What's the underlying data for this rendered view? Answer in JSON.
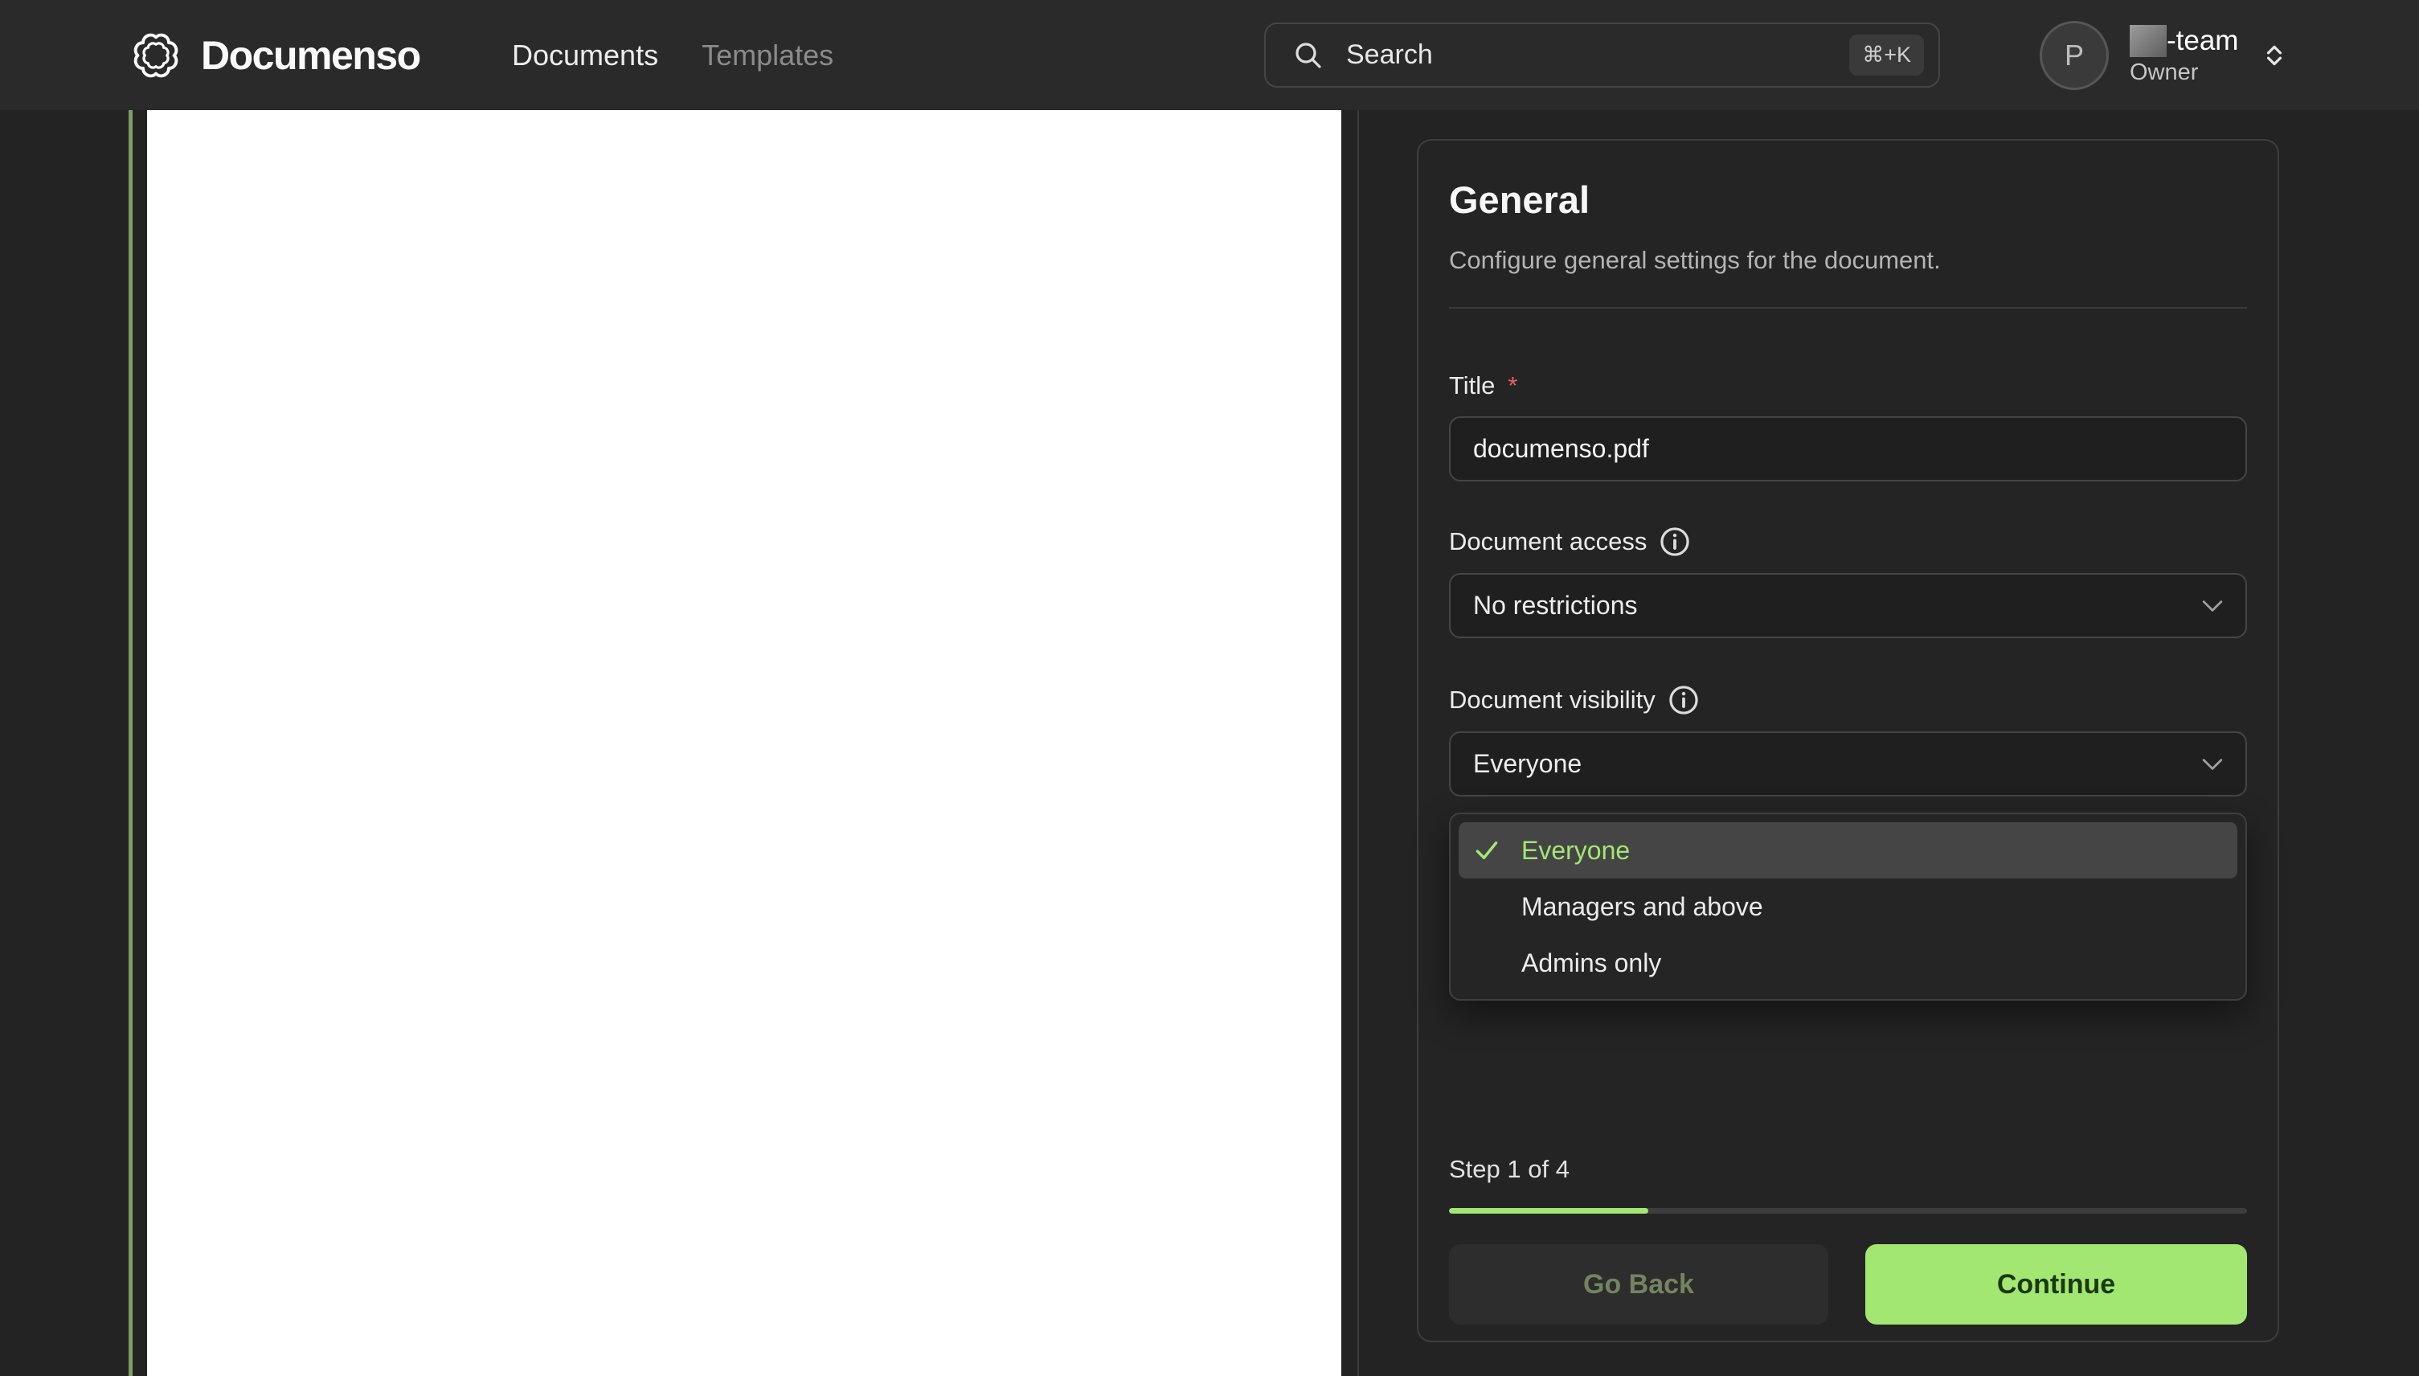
{
  "navbar": {
    "brand": "Documenso",
    "nav_items": [
      {
        "label": "Documents",
        "active": true
      },
      {
        "label": "Templates",
        "active": false
      }
    ],
    "search": {
      "placeholder": "Search",
      "shortcut": "⌘+K"
    },
    "user": {
      "avatar_initial": "P",
      "team_suffix": "-team",
      "role": "Owner"
    }
  },
  "panel": {
    "title": "General",
    "subtitle": "Configure general settings for the document.",
    "fields": {
      "title": {
        "label": "Title",
        "required_mark": "*",
        "value": "documenso.pdf"
      },
      "access": {
        "label": "Document access",
        "value": "No restrictions"
      },
      "visibility": {
        "label": "Document visibility",
        "value": "Everyone"
      }
    },
    "visibility_dropdown": {
      "options": [
        {
          "label": "Everyone",
          "selected": true
        },
        {
          "label": "Managers and above",
          "selected": false
        },
        {
          "label": "Admins only",
          "selected": false
        }
      ]
    },
    "step": {
      "text": "Step 1 of 4",
      "progress_percent": 25
    },
    "buttons": {
      "back": "Go Back",
      "continue": "Continue"
    }
  },
  "colors": {
    "accent": "#a2e771",
    "accent_text_on_fill": "#1c380e",
    "muted_green_rule": "#7f9e62",
    "required_mark": "#e8615f",
    "selected_option_bg": "#454545"
  }
}
